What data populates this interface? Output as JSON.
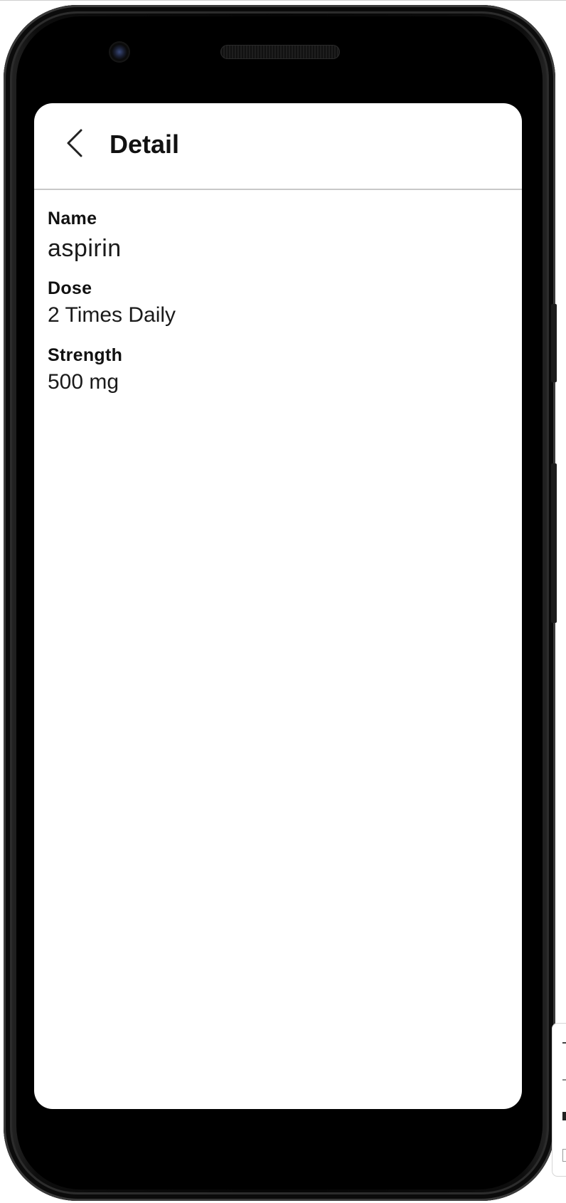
{
  "app_bar": {
    "title": "Detail",
    "back_icon": "chevron-left-icon"
  },
  "fields": {
    "name": {
      "label": "Name",
      "value": "aspirin"
    },
    "dose": {
      "label": "Dose",
      "value": "2 Times Daily"
    },
    "strength": {
      "label": "Strength",
      "value": "500 mg"
    }
  },
  "colors": {
    "screen_background": "#ffffff",
    "text_primary": "#111111",
    "divider": "#c8c8c8",
    "device_frame": "#050505"
  }
}
